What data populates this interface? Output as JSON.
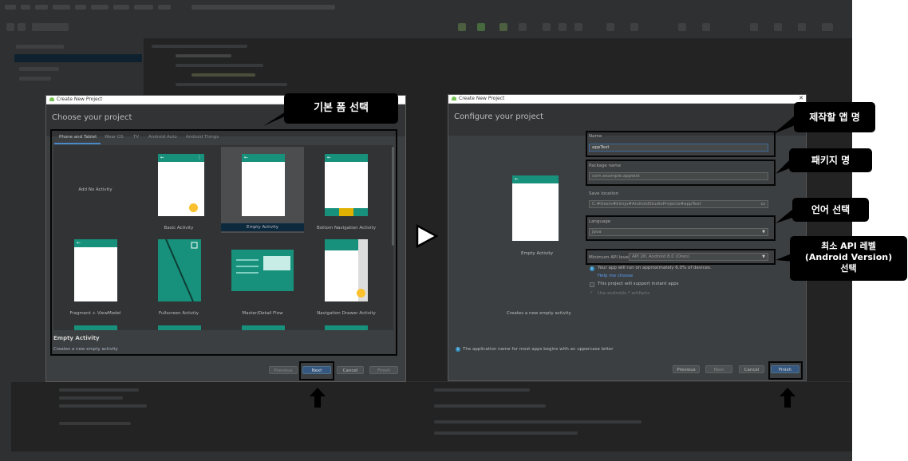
{
  "left_dialog": {
    "window_title": "Create New Project",
    "header": "Choose your project",
    "tabs": [
      "Phone and Tablet",
      "Wear OS",
      "TV",
      "Android Auto",
      "Android Things"
    ],
    "templates": [
      {
        "label": "Add No Activity"
      },
      {
        "label": "Basic Activity"
      },
      {
        "label": "Empty Activity"
      },
      {
        "label": "Bottom Navigation Activity"
      },
      {
        "label": "Fragment + ViewModel"
      },
      {
        "label": "Fullscreen Activity"
      },
      {
        "label": "Master/Detail Flow"
      },
      {
        "label": "Navigation Drawer Activity"
      }
    ],
    "selected_template": "Empty Activity",
    "description_title": "Empty Activity",
    "description_text": "Creates a new empty activity",
    "buttons": {
      "previous": "Previous",
      "next": "Next",
      "cancel": "Cancel",
      "finish": "Finish"
    }
  },
  "right_dialog": {
    "window_title": "Create New Project",
    "header": "Configure your project",
    "preview_label": "Empty Activity",
    "preview_description": "Creates a new empty activity",
    "name_label": "Name",
    "name_value": "appText",
    "package_label": "Package name",
    "package_value": "com.example.apptest",
    "save_label": "Save location",
    "save_value": "C:#Users#kimju#AndroidStudioProjects#appText",
    "language_label": "Language",
    "language_value": "Java",
    "min_api_label": "Minimum API level",
    "min_api_value": "API 26: Android 8.0 (Oreo)",
    "info_text": "Your app will run on approximately 6.0% of devices.",
    "help_link": "Help me choose",
    "instant_apps": "This project will support instant apps",
    "androidx": "Use androidx.* artifacts",
    "footer_note": "The application name for most apps begins with an uppercase letter",
    "buttons": {
      "previous": "Previous",
      "next": "Next",
      "cancel": "Cancel",
      "finish": "Finish"
    }
  },
  "annotations": {
    "form_select": "기본 폼 선택",
    "app_name": "제작할 앱 명",
    "package_name": "패키지 명",
    "language_select": "언어 선택",
    "min_api_line1": "최소 API 레벨",
    "min_api_line2": "(Android Version)",
    "min_api_line3": "선택"
  },
  "icons": {
    "flow_arrow": "play-triangle-outline-icon",
    "pointer": "up-arrow-icon"
  },
  "colors": {
    "ide_bg": "#2b2b2b",
    "dialog_bg": "#3c3f41",
    "header_bg": "#313335",
    "accent_teal": "#17917b",
    "primary_button": "#365880",
    "callout_bg": "#000000",
    "fab": "#fbc02d"
  }
}
